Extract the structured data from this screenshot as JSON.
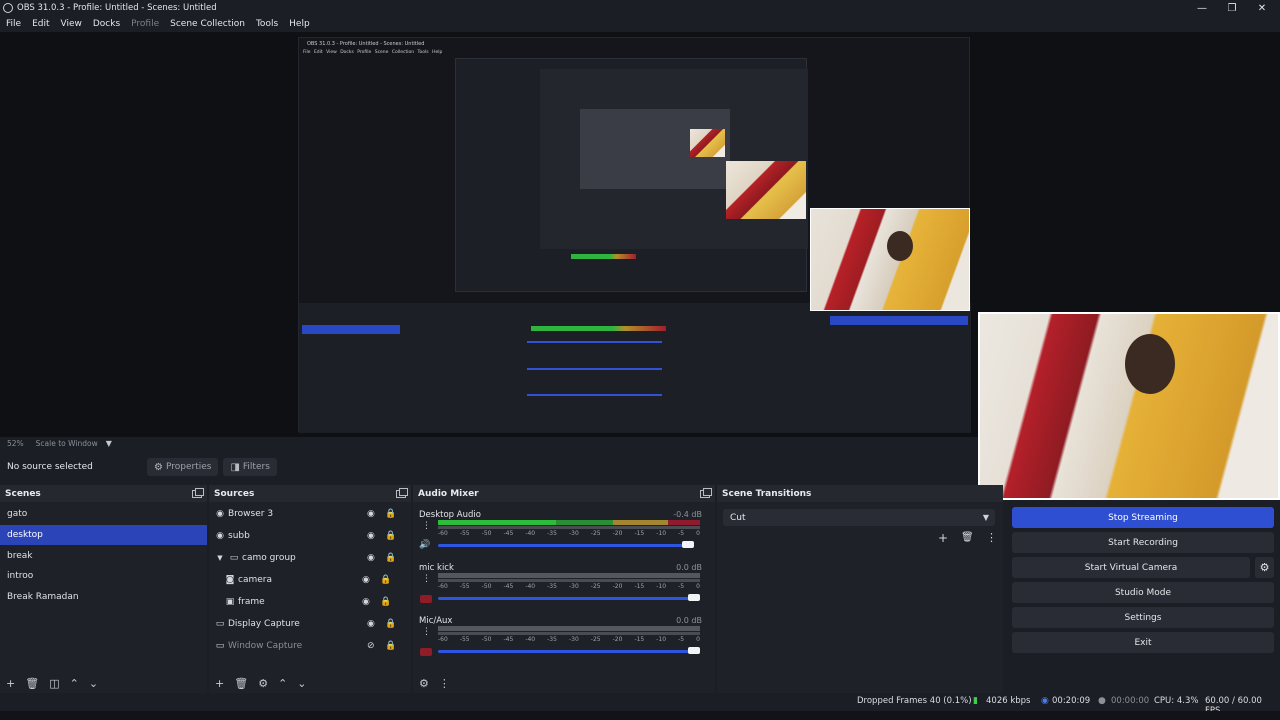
{
  "window": {
    "title": "OBS 31.0.3 - Profile: Untitled - Scenes: Untitled",
    "controls": [
      "—",
      "❐",
      "✕"
    ]
  },
  "menu": [
    "File",
    "Edit",
    "View",
    "Docks",
    "Profile",
    "Scene Collection",
    "Tools",
    "Help"
  ],
  "preview": {
    "nested_title": "OBS 31.0.3 - Profile: Untitled - Scenes: Untitled",
    "nested_menu": "File Edit View Docks Profile Scene Collection Tools Help"
  },
  "scale": {
    "percent": "52%",
    "mode": "Scale to Window"
  },
  "context": {
    "no_source": "No source selected",
    "properties_label": "Properties",
    "filters_label": "Filters"
  },
  "scenes": {
    "title": "Scenes",
    "items": [
      "gato",
      "desktop",
      "break",
      "introo",
      "Break Ramadan"
    ],
    "selected": "desktop"
  },
  "sources": {
    "title": "Sources",
    "items": [
      {
        "label": "Browser 3",
        "icon": "globe-icon"
      },
      {
        "label": "subb",
        "icon": "globe-icon"
      },
      {
        "label": "camo group",
        "icon": "folder-icon"
      },
      {
        "label": "camera",
        "icon": "camera-icon"
      },
      {
        "label": "frame",
        "icon": "image-icon"
      },
      {
        "label": "Display Capture",
        "icon": "monitor-icon"
      },
      {
        "label": "Window Capture",
        "icon": "window-icon"
      }
    ]
  },
  "audio": {
    "title": "Audio Mixer",
    "channels": [
      {
        "name": "Desktop Audio",
        "db": "-0.4 dB",
        "level": 0.98,
        "volume": 0.95
      },
      {
        "name": "mic kick",
        "db": "0.0 dB",
        "level": 0.0,
        "volume": 1.0
      },
      {
        "name": "Mic/Aux",
        "db": "0.0 dB",
        "level": 0.0,
        "volume": 1.0
      }
    ],
    "ticks": [
      "-60",
      "-55",
      "-50",
      "-45",
      "-40",
      "-35",
      "-30",
      "-25",
      "-20",
      "-15",
      "-10",
      "-5",
      "0"
    ]
  },
  "transitions": {
    "title": "Scene Transitions",
    "selected": "Cut"
  },
  "controls": {
    "stop_streaming": "Stop Streaming",
    "start_recording": "Start Recording",
    "start_virtual_camera": "Start Virtual Camera",
    "studio_mode": "Studio Mode",
    "settings": "Settings",
    "exit": "Exit"
  },
  "status": {
    "dropped_frames": "Dropped Frames 40 (0.1%)",
    "bitrate": "4026 kbps",
    "stream_time": "00:20:09",
    "record_time": "00:00:00",
    "cpu": "CPU: 4.3%",
    "fps": "60.00 / 60.00 FPS"
  },
  "colors": {
    "accent": "#2e4fd1",
    "selection": "#2b44b8",
    "meter_green": "#2ebd3b",
    "bitrate_green": "#3bd04a"
  }
}
